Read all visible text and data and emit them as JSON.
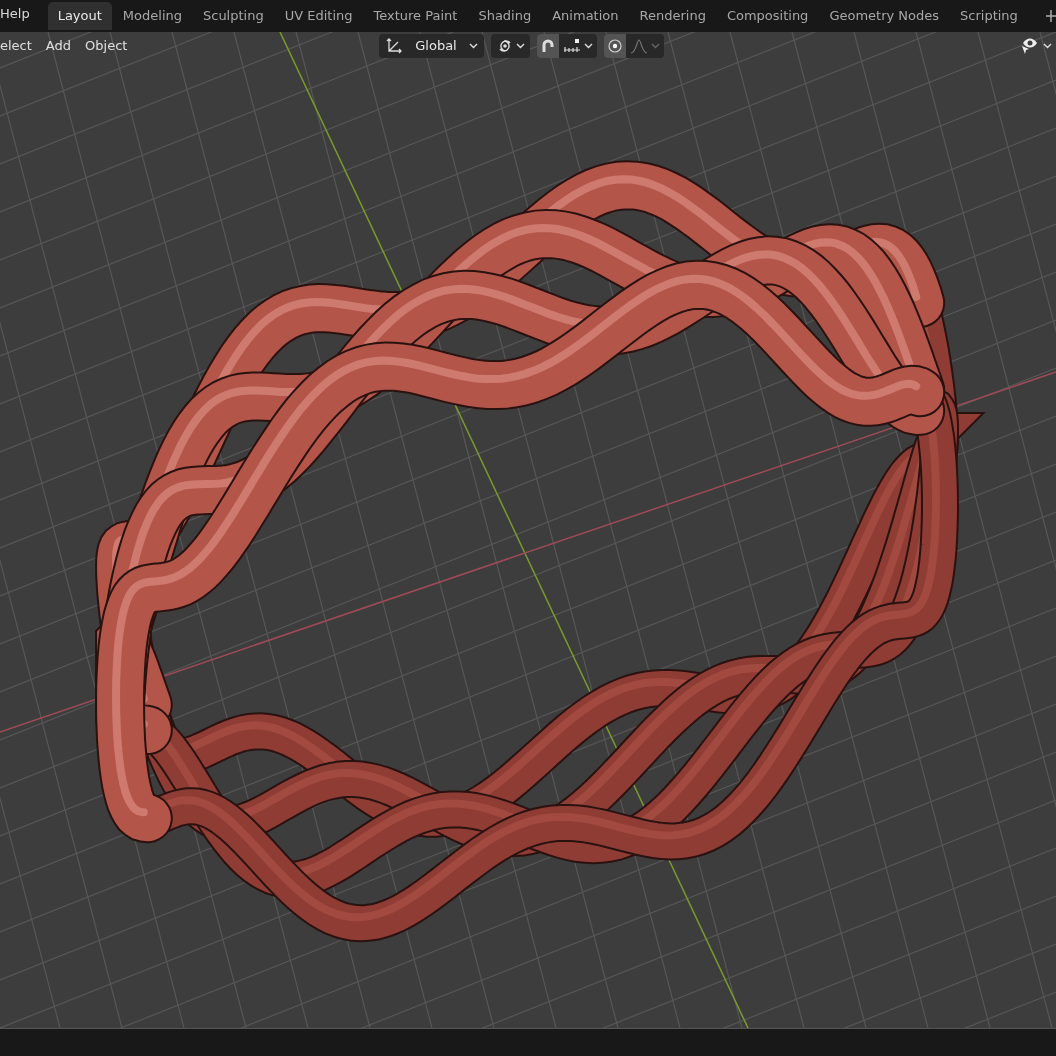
{
  "top_bar": {
    "menus": [
      {
        "label": "Help"
      }
    ],
    "workspace_tabs": [
      {
        "label": "Layout",
        "selected": true
      },
      {
        "label": "Modeling",
        "selected": false
      },
      {
        "label": "Sculpting",
        "selected": false
      },
      {
        "label": "UV Editing",
        "selected": false
      },
      {
        "label": "Texture Paint",
        "selected": false
      },
      {
        "label": "Shading",
        "selected": false
      },
      {
        "label": "Animation",
        "selected": false
      },
      {
        "label": "Rendering",
        "selected": false
      },
      {
        "label": "Compositing",
        "selected": false
      },
      {
        "label": "Geometry Nodes",
        "selected": false
      },
      {
        "label": "Scripting",
        "selected": false
      }
    ]
  },
  "viewport_header": {
    "menus": [
      {
        "label": "elect"
      },
      {
        "label": "Add"
      },
      {
        "label": "Object"
      }
    ],
    "transform_orientation": "Global",
    "snapping": {
      "on": true
    },
    "proportional_editing": {
      "on": true
    }
  }
}
